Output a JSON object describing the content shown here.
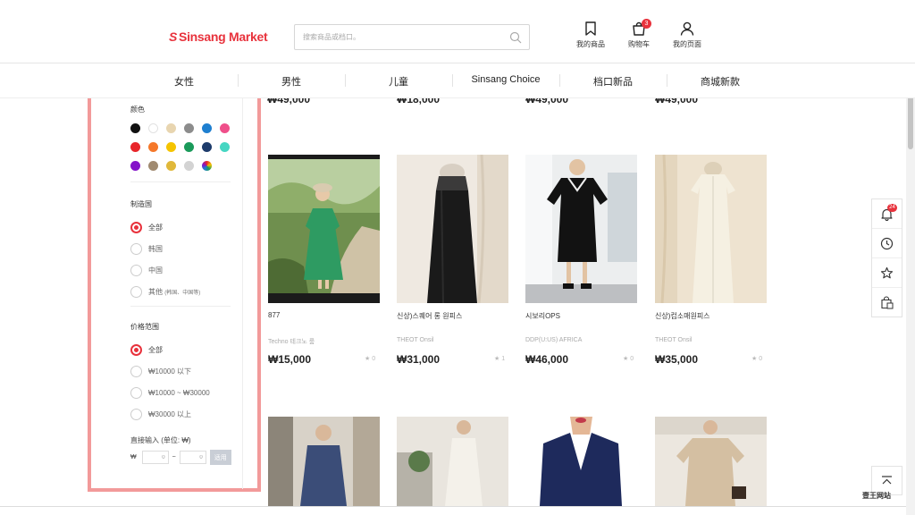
{
  "header": {
    "logo": "Sinsang Market",
    "logo_mark": "S",
    "search_placeholder": "搜索商品或档口。",
    "icons": [
      {
        "label": "我的商品",
        "icon": "bookmark-icon"
      },
      {
        "label": "购物车",
        "icon": "cart-icon",
        "badge": "3"
      },
      {
        "label": "我的页面",
        "icon": "user-icon"
      }
    ]
  },
  "nav": [
    "女性",
    "男性",
    "儿童",
    "Sinsang Choice",
    "档口新品",
    "商城新款"
  ],
  "sidebar": {
    "color_title": "颜色",
    "colors": [
      "#111111",
      "#ffffff",
      "#e8d5b0",
      "#8c8c8c",
      "#1e7fd0",
      "#ef4f8a",
      "#e8252a",
      "#f5782a",
      "#f5c400",
      "#1a9a5a",
      "#1d3b6b",
      "#45d6c2",
      "#8414c9",
      "#a08a70",
      "#e0b83a",
      "#d3d3d3",
      "rainbow"
    ],
    "origin_title": "制造国",
    "origin_options": [
      {
        "label": "全部",
        "selected": true
      },
      {
        "label": "韩国",
        "selected": false
      },
      {
        "label": "中国",
        "selected": false
      },
      {
        "label": "其他",
        "note": "(韩国、中国等)",
        "selected": false
      }
    ],
    "price_title": "价格范围",
    "price_options": [
      {
        "label": "全部",
        "selected": true
      },
      {
        "label": "₩10000 以下",
        "selected": false
      },
      {
        "label": "₩10000 ~ ₩30000",
        "selected": false
      },
      {
        "label": "₩30000 以上",
        "selected": false
      }
    ],
    "direct_input_label": "直接输入 (单位: ₩)",
    "currency": "₩",
    "min_value": "0",
    "max_value": "0",
    "tilde": "~",
    "apply_label": "适用"
  },
  "prev_row": [
    {
      "price": "₩49,000"
    },
    {
      "price": "₩18,000"
    },
    {
      "price": "₩49,000"
    },
    {
      "price": "₩49,000"
    }
  ],
  "products": [
    {
      "name": "877",
      "shop": "Techno 테크노 룸",
      "price": "₩15,000",
      "likes": "0"
    },
    {
      "name": "신상)스퀘어 롱 원피스",
      "shop": "THEOT Onsil",
      "price": "₩31,000",
      "likes": "1"
    },
    {
      "name": "시보리OPS",
      "shop": "DDP(U:US) AFRICA",
      "price": "₩46,000",
      "likes": "0"
    },
    {
      "name": "신상)컵소매원피스",
      "shop": "THEOT Onsil",
      "price": "₩35,000",
      "likes": "0"
    }
  ],
  "rail": {
    "notification_badge": "24"
  },
  "watermark": "壹王网站"
}
